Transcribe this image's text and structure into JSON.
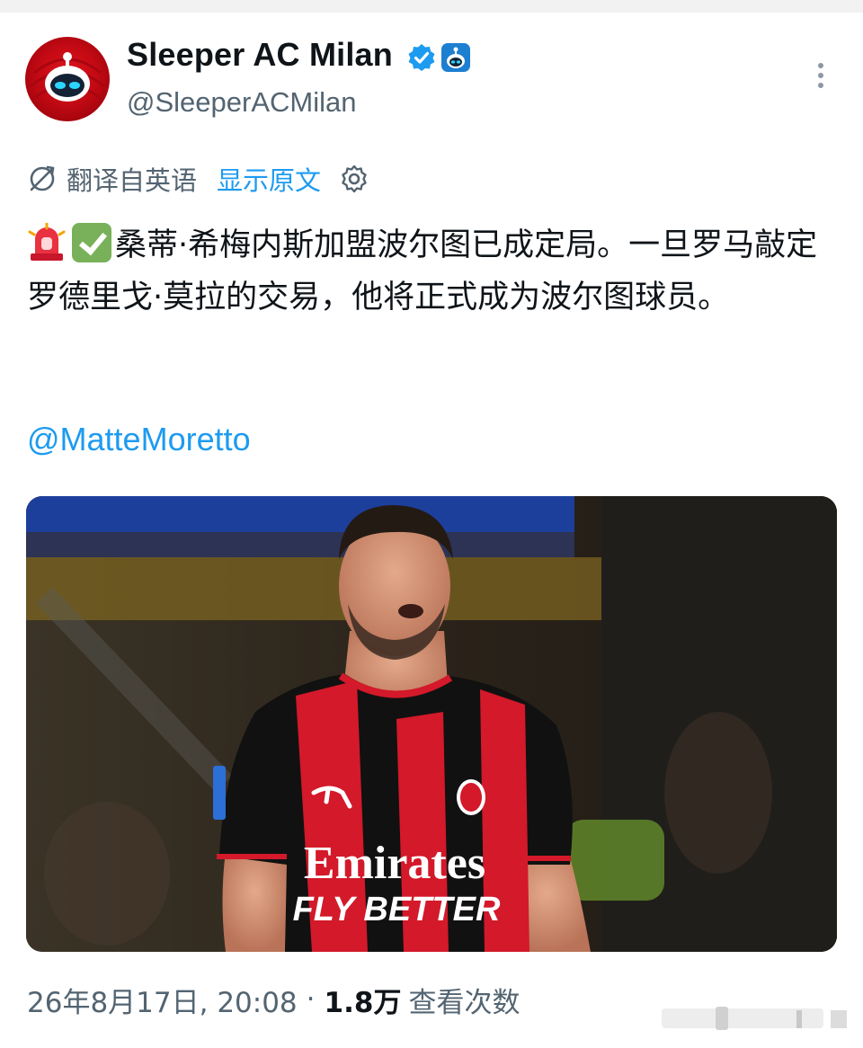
{
  "tweet": {
    "display_name": "Sleeper AC Milan",
    "handle": "@SleeperACMilan",
    "translation": {
      "label": "翻译自英语",
      "show_original": "显示原文"
    },
    "text": "桑蒂·希梅内斯加盟波尔图已成定局。一旦罗马敲定罗德里戈·莫拉的交易，他将正式成为波尔图球员。",
    "mention": "@MatteMoretto",
    "photo": {
      "shirt_sponsor_line1": "Emirates",
      "shirt_sponsor_line2": "FLY BETTER"
    },
    "timestamp": "26年8月17日, 20:08",
    "separator": "·",
    "view_count": "1.8万",
    "view_label": "查看次数"
  },
  "icons": {
    "verified": "verified-badge-icon",
    "affiliate": "affiliate-badge-icon",
    "more": "more-vertical-icon",
    "translate": "translate-icon",
    "settings": "gear-icon",
    "siren": "siren-emoji",
    "check": "check-mark-emoji"
  },
  "colors": {
    "link": "#1d9bf0",
    "secondary_text": "#536471",
    "primary_text": "#0f1419",
    "verified": "#1d9bf0",
    "milan_red": "#e0141e"
  }
}
